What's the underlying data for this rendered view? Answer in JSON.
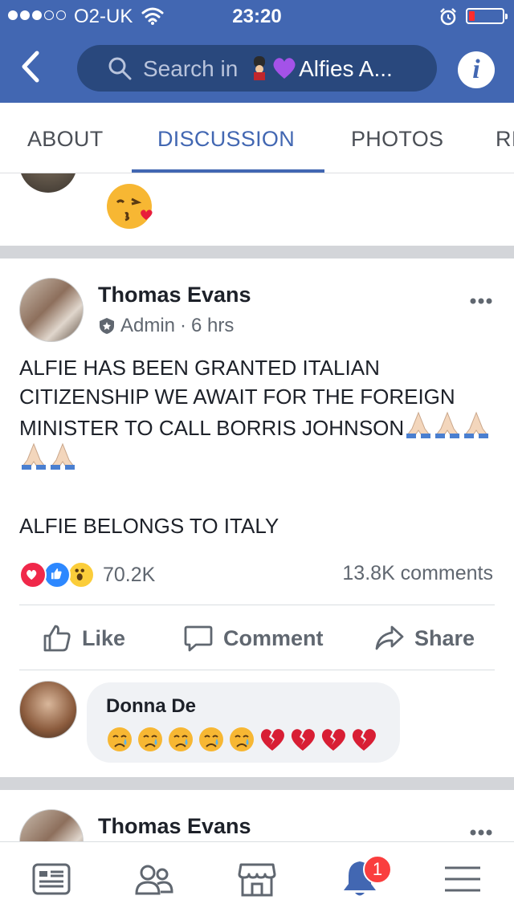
{
  "status_bar": {
    "carrier": "O2-UK",
    "time": "23:20",
    "signal_bars_filled": 3,
    "signal_bars_total": 5,
    "battery_level_fraction": 0.1,
    "battery_color": "#ff2d2d"
  },
  "header": {
    "search_prefix": "Search in ",
    "search_title": "Alfies A...",
    "search_title_emojis": [
      "guardsman-emoji",
      "purple-heart-emoji"
    ],
    "info_glyph": "i",
    "color": "#4267b2"
  },
  "tabs": {
    "items": [
      {
        "label": "ABOUT",
        "active": false
      },
      {
        "label": "DISCUSSION",
        "active": true
      },
      {
        "label": "PHOTOS",
        "active": false
      },
      {
        "label": "RI",
        "active": false
      }
    ],
    "active_color": "#4267b2"
  },
  "previous_post": {
    "emoji": "face-blowing-kiss-emoji"
  },
  "post": {
    "author": "Thomas Evans",
    "role": "Admin",
    "separator": "·",
    "time": "6 hrs",
    "text_line1": "ALFIE HAS BEEN GRANTED ITALIAN CITIZENSHIP WE AWAIT FOR THE FOREIGN MINISTER TO CALL BORRIS JOHNSON",
    "text_emoji_count": 5,
    "text_line2": "ALFIE BELONGS TO ITALY",
    "reactions": {
      "types": [
        "love",
        "like",
        "wow"
      ],
      "count": "70.2K"
    },
    "comments_count": "13.8K comments",
    "actions": {
      "like": "Like",
      "comment": "Comment",
      "share": "Share"
    },
    "top_comment": {
      "author": "Donna De",
      "emojis": [
        "crying-face",
        "crying-face",
        "crying-face",
        "crying-face",
        "crying-face",
        "broken-heart",
        "broken-heart",
        "broken-heart",
        "broken-heart"
      ]
    }
  },
  "next_post": {
    "author": "Thomas Evans"
  },
  "bottom_nav": {
    "items": [
      "news-feed-icon",
      "groups-icon",
      "marketplace-icon",
      "notifications-icon",
      "menu-icon"
    ],
    "notifications_badge": "1"
  }
}
